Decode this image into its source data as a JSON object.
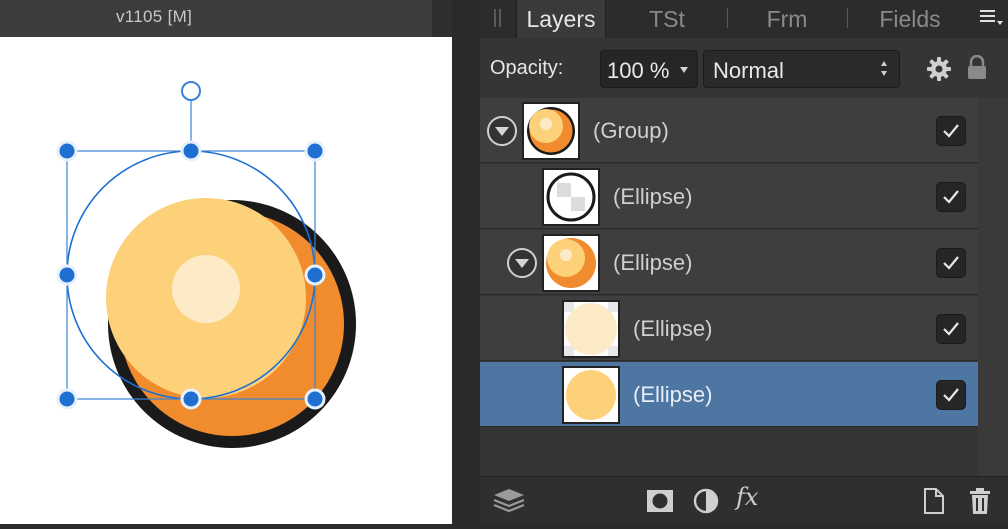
{
  "document": {
    "title": "v1105  [M]"
  },
  "panel": {
    "tabs": [
      {
        "label": "Layers",
        "active": true
      },
      {
        "label": "TSt",
        "active": false
      },
      {
        "label": "Frm",
        "active": false
      },
      {
        "label": "Fields",
        "active": false
      }
    ],
    "opacity_label": "Opacity:",
    "opacity_value": "100 %",
    "blend_mode": "Normal",
    "layers": [
      {
        "name": "(Group)",
        "indent": 0,
        "expanded": true,
        "selected": false,
        "visible": true,
        "thumb": "orange-ball"
      },
      {
        "name": "(Ellipse)",
        "indent": 1,
        "expanded": null,
        "selected": false,
        "visible": true,
        "thumb": "ring"
      },
      {
        "name": "(Ellipse)",
        "indent": 1,
        "expanded": true,
        "selected": false,
        "visible": true,
        "thumb": "orange-ball-small"
      },
      {
        "name": "(Ellipse)",
        "indent": 2,
        "expanded": null,
        "selected": false,
        "visible": true,
        "thumb": "highlight"
      },
      {
        "name": "(Ellipse)",
        "indent": 2,
        "expanded": null,
        "selected": true,
        "visible": true,
        "thumb": "yellow-disc"
      }
    ],
    "footer_icons": [
      "layers-stack-icon",
      "mask-icon",
      "adjustment-icon",
      "fx-icon",
      "new-layer-icon",
      "trash-icon"
    ],
    "fx_label": "fx"
  },
  "colors": {
    "selection_blue": "#4e76a3",
    "handle_blue": "#1f6fd1",
    "ball_yellow": "#fdd17a",
    "ball_orange": "#f08c2e",
    "ball_outline": "#1a1a1a",
    "highlight": "#fdebc8"
  }
}
